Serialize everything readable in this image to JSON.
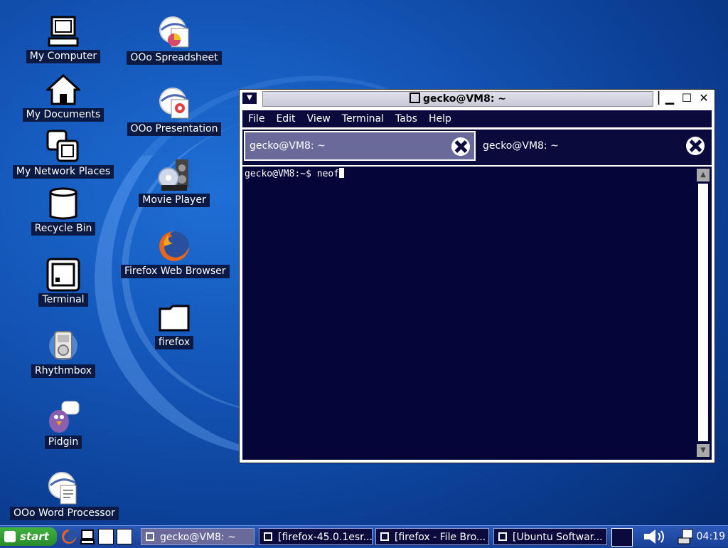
{
  "desktop": {
    "icons_left": [
      {
        "label": "My Computer",
        "icon": "computer-icon"
      },
      {
        "label": "My Documents",
        "icon": "home-icon"
      },
      {
        "label": "My Network Places",
        "icon": "network-icon"
      },
      {
        "label": "Recycle Bin",
        "icon": "trash-icon"
      },
      {
        "label": "Terminal",
        "icon": "terminal-icon"
      },
      {
        "label": "Rhythmbox",
        "icon": "music-icon"
      },
      {
        "label": "Pidgin",
        "icon": "pidgin-icon"
      },
      {
        "label": "OOo Word Processor",
        "icon": "writer-icon"
      }
    ],
    "icons_right": [
      {
        "label": "OOo Spreadsheet",
        "icon": "spreadsheet-icon"
      },
      {
        "label": "OOo Presentation",
        "icon": "presentation-icon"
      },
      {
        "label": "Movie Player",
        "icon": "movie-icon"
      },
      {
        "label": "Firefox Web Browser",
        "icon": "firefox-icon"
      },
      {
        "label": "firefox",
        "icon": "folder-icon"
      }
    ]
  },
  "window": {
    "title": "gecko@VM8: ~",
    "menu": [
      "File",
      "Edit",
      "View",
      "Terminal",
      "Tabs",
      "Help"
    ],
    "tabs": [
      {
        "label": "gecko@VM8: ~",
        "active": true
      },
      {
        "label": "gecko@VM8: ~",
        "active": false
      }
    ],
    "terminal": {
      "prompt": "gecko@VM8:~$ ",
      "command": "neof"
    }
  },
  "taskbar": {
    "start_label": "start",
    "tasks": [
      {
        "label": "gecko@VM8: ~",
        "active": true
      },
      {
        "label": "[firefox-45.0.1esr...",
        "active": false
      },
      {
        "label": "[firefox - File Bro...",
        "active": false
      },
      {
        "label": "[Ubuntu Softwar...",
        "active": false
      }
    ],
    "clock": "04:19"
  }
}
